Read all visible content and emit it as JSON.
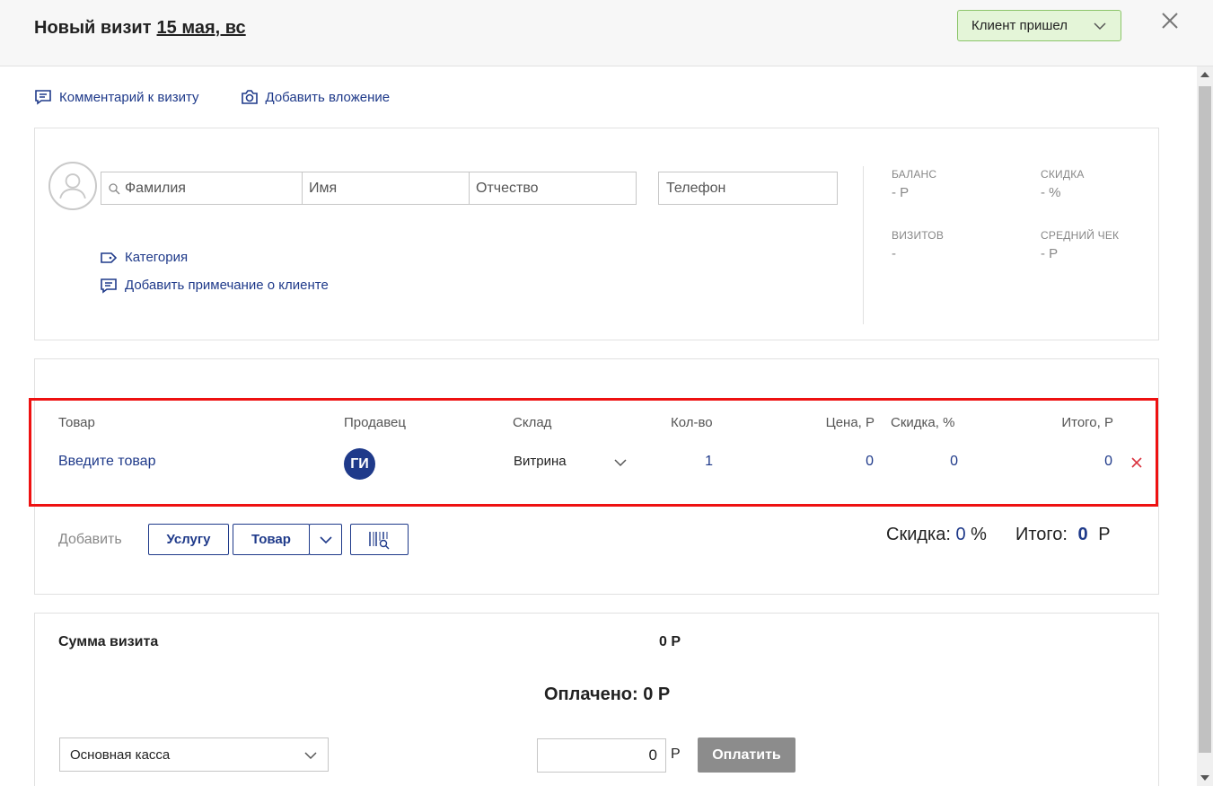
{
  "header": {
    "title": "Новый визит",
    "date": "15 мая, вс",
    "status": "Клиент пришел"
  },
  "links": {
    "comment": "Комментарий к визиту",
    "attachment": "Добавить вложение"
  },
  "client": {
    "lastname_placeholder": "Фамилия",
    "firstname_placeholder": "Имя",
    "middlename_placeholder": "Отчество",
    "phone_placeholder": "Телефон",
    "category": "Категория",
    "note": "Добавить примечание о клиенте",
    "stats": {
      "balance_label": "БАЛАНС",
      "balance_value": "- Р",
      "discount_label": "СКИДКА",
      "discount_value": "- %",
      "visits_label": "ВИЗИТОВ",
      "visits_value": "-",
      "avg_label": "СРЕДНИЙ ЧЕК",
      "avg_value": "- Р"
    }
  },
  "goods": {
    "headers": {
      "product": "Товар",
      "seller": "Продавец",
      "warehouse": "Склад",
      "qty": "Кол-во",
      "price": "Цена, Р",
      "discount": "Скидка, %",
      "total": "Итого, Р"
    },
    "row": {
      "product": "Введите товар",
      "seller_initials": "ГИ",
      "warehouse": "Витрина",
      "qty": "1",
      "price": "0",
      "discount": "0",
      "total": "0"
    },
    "add_label": "Добавить",
    "service_button": "Услугу",
    "product_button": "Товар",
    "discount_label": "Скидка:",
    "discount_value": "0",
    "discount_unit": "%",
    "total_label": "Итого:",
    "total_value": "0",
    "total_unit": "Р"
  },
  "summary": {
    "label": "Сумма визита",
    "value": "0 Р",
    "paid": "Оплачено: 0 Р",
    "cashbox": "Основная касса",
    "amount": "0",
    "currency": "Р",
    "pay_button": "Оплатить"
  },
  "colors": {
    "accent": "#1f3a8a",
    "status_bg": "#e4f5d8",
    "highlight": "#ee1111"
  }
}
